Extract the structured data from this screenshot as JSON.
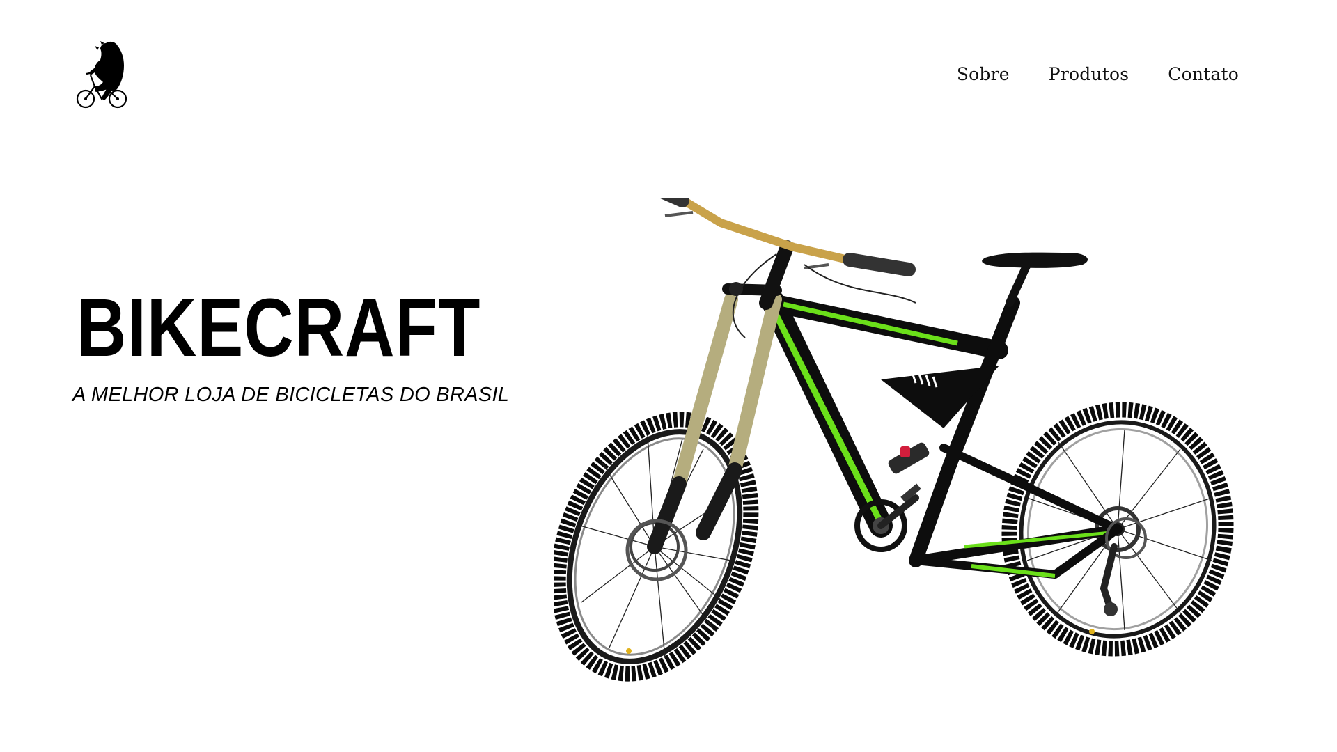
{
  "header": {
    "logo": {
      "icon": "bear-riding-bicycle-logo"
    },
    "nav": [
      {
        "label": "Sobre"
      },
      {
        "label": "Produtos"
      },
      {
        "label": "Contato"
      }
    ]
  },
  "hero": {
    "title": "BIKECRAFT",
    "subtitle": "A MELHOR LOJA DE BICICLETAS DO BRASIL",
    "image": {
      "icon": "mountain-bike-image"
    }
  },
  "colors": {
    "background": "#ffffff",
    "text": "#000000",
    "bike_accent": "#6be01a",
    "bike_frame": "#111111",
    "handlebar": "#c9a24a",
    "fork": "#b5ad7e"
  }
}
